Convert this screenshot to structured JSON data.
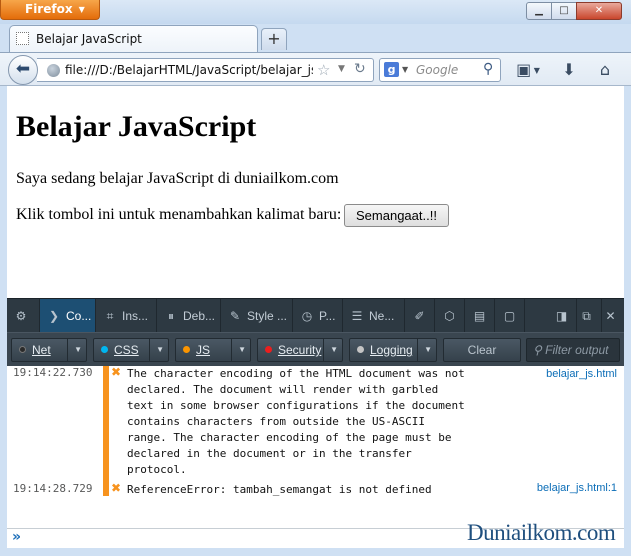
{
  "window": {
    "app_button": "Firefox",
    "controls": {
      "minimize": "▁",
      "maximize": "□",
      "close": "✕"
    }
  },
  "tabs": [
    {
      "title": "Belajar JavaScript"
    }
  ],
  "new_tab_label": "+",
  "nav": {
    "url": "file:///D:/BelajarHTML/JavaScript/belajar_js.html",
    "search_engine": "g",
    "search_placeholder": "Google"
  },
  "page": {
    "heading": "Belajar JavaScript",
    "paragraph": "Saya sedang belajar JavaScript di duniailkom.com",
    "prompt_text": "Klik tombol ini untuk menambahkan kalimat baru:",
    "button_label": "Semangaat..!!"
  },
  "devtools": {
    "tabs": [
      {
        "label": "",
        "icon": "gear-icon"
      },
      {
        "label": "Co...",
        "icon": "console-icon"
      },
      {
        "label": "Ins...",
        "icon": "inspector-icon"
      },
      {
        "label": "Deb...",
        "icon": "debugger-icon"
      },
      {
        "label": "Style ...",
        "icon": "style-editor-icon"
      },
      {
        "label": "P...",
        "icon": "profiler-icon"
      },
      {
        "label": "Ne...",
        "icon": "network-icon"
      }
    ],
    "filters": {
      "net": "Net",
      "css": "CSS",
      "js": "JS",
      "security": "Security",
      "logging": "Logging",
      "clear": "Clear",
      "filter_placeholder": "Filter output"
    },
    "colors": {
      "net": "#2a2a2a",
      "css": "#00b6f0",
      "js": "#fb9500",
      "security": "#ec1e1e",
      "logging": "#c4c4c4",
      "error_accent": "#f7931e"
    },
    "messages": [
      {
        "time": "19:14:22.730",
        "text": "The character encoding of the HTML document was not\ndeclared. The document will render with garbled\ntext in some browser configurations if the document\ncontains characters from outside the US-ASCII\nrange. The character encoding of the page must be\ndeclared in the document or in the transfer\nprotocol.",
        "location": "belajar_js.html"
      },
      {
        "time": "19:14:28.729",
        "text": "ReferenceError: tambah_semangat is not defined",
        "location": "belajar_js.html:1"
      }
    ],
    "input_prompt": "»"
  },
  "watermark": "Duniailkom.com"
}
